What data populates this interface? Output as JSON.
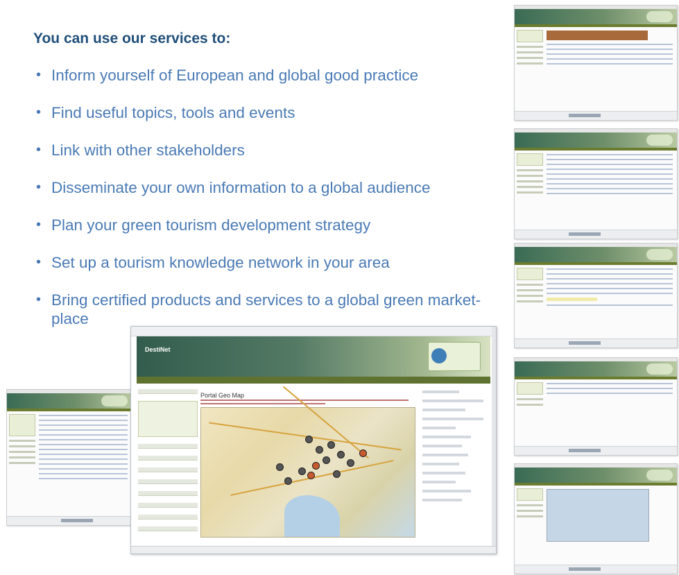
{
  "heading": "You can use our services to:",
  "bullets": [
    "Inform yourself of European and global good practice",
    "Find useful topics, tools and events",
    "Link with other stakeholders",
    "Disseminate your own information to a global audience",
    "Plan your green tourism development strategy",
    "Set up a tourism knowledge network in your area",
    "Bring certified products and services to a global green market-\nplace"
  ],
  "browser": {
    "logo": "DestiNet",
    "page_title": "Portal Geo Map"
  }
}
